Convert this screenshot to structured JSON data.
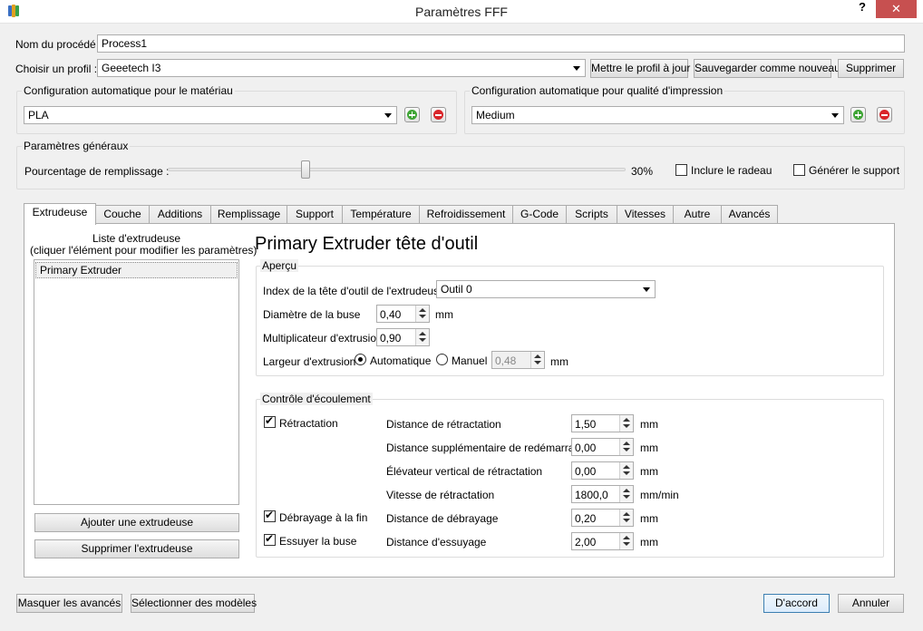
{
  "window": {
    "title": "Paramètres FFF",
    "help": "?",
    "close": "✕"
  },
  "header": {
    "process_label": "Nom du procédé :",
    "process_value": "Process1",
    "profile_label": "Choisir un profil :",
    "profile_value": "Geeetech I3",
    "update_button": "Mettre le profil à jour",
    "save_new_button": "Sauvegarder comme nouveau",
    "delete_button": "Supprimer"
  },
  "material": {
    "title": "Configuration automatique pour le matériau",
    "value": "PLA"
  },
  "quality": {
    "title": "Configuration automatique pour qualité d'impression",
    "value": "Medium"
  },
  "general": {
    "title": "Paramètres généraux",
    "infill_label": "Pourcentage de remplissage :",
    "infill_value": "30%",
    "infill_fraction": 0.3,
    "raft_label": "Inclure le radeau",
    "support_label": "Générer le support"
  },
  "tabs": [
    "Extrudeuse",
    "Couche",
    "Additions",
    "Remplissage",
    "Support",
    "Température",
    "Refroidissement",
    "G-Code",
    "Scripts",
    "Vitesses",
    "Autre",
    "Avancés"
  ],
  "extruder_list": {
    "title_line1": "Liste d'extrudeuse",
    "title_line2": "(cliquer l'élément pour modifier les paramètres)",
    "items": [
      "Primary Extruder"
    ],
    "add_button": "Ajouter une extrudeuse",
    "remove_button": "Supprimer l'extrudeuse"
  },
  "editor": {
    "heading": "Primary Extruder tête d'outil",
    "overview": {
      "title": "Aperçu",
      "tool_index_label": "Index de la tête d'outil de l'extrudeuse",
      "tool_index_value": "Outil 0",
      "nozzle_label": "Diamètre de la buse",
      "nozzle_value": "0,40",
      "nozzle_unit": "mm",
      "multiplier_label": "Multiplicateur d'extrusion",
      "multiplier_value": "0,90",
      "width_label": "Largeur d'extrusion",
      "auto_label": "Automatique",
      "manual_label": "Manuel",
      "manual_value": "0,48",
      "manual_unit": "mm"
    },
    "flow": {
      "title": "Contrôle d'écoulement",
      "retraction_label": "Rétractation",
      "coast_label": "Débrayage à la fin",
      "wipe_label": "Essuyer la buse",
      "rows": [
        {
          "label": "Distance de rétractation",
          "value": "1,50",
          "unit": "mm"
        },
        {
          "label": "Distance supplémentaire de redémarrage",
          "value": "0,00",
          "unit": "mm"
        },
        {
          "label": "Élévateur vertical de rétractation",
          "value": "0,00",
          "unit": "mm"
        },
        {
          "label": "Vitesse de rétractation",
          "value": "1800,0",
          "unit": "mm/min"
        },
        {
          "label": "Distance de débrayage",
          "value": "0,20",
          "unit": "mm"
        },
        {
          "label": "Distance d'essuyage",
          "value": "2,00",
          "unit": "mm"
        }
      ]
    }
  },
  "footer": {
    "hide_advanced": "Masquer les avancés",
    "select_models": "Sélectionner des modèles",
    "ok": "D'accord",
    "cancel": "Annuler"
  },
  "colors": {
    "close": "#c75050",
    "plus": "#3fa535",
    "minus": "#d9252a"
  },
  "icons": {
    "app": "app-logo-icon",
    "add": "plus-circle-icon",
    "remove": "minus-circle-icon"
  }
}
